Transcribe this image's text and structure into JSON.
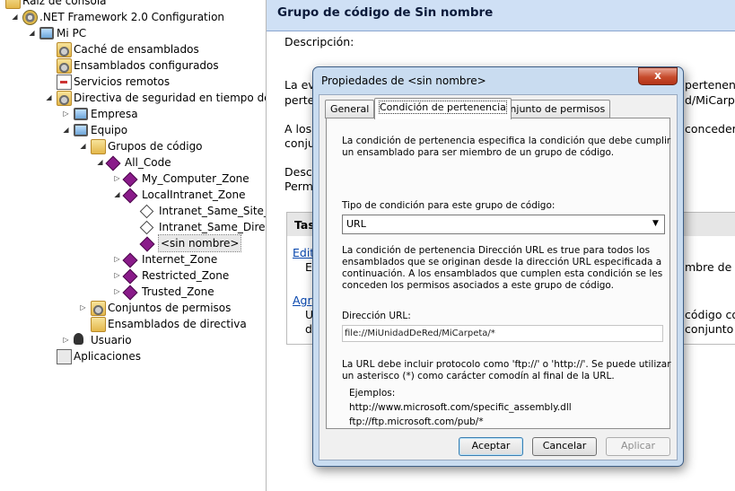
{
  "tree": [
    {
      "label": "Raíz de consola",
      "icon": "folder-icon",
      "level": 0
    },
    {
      "label": ".NET Framework 2.0 Configuration",
      "icon": "config-icon",
      "level": 1
    },
    {
      "label": "Mi PC",
      "icon": "computer-icon",
      "level": 2
    },
    {
      "label": "Caché de ensamblados",
      "icon": "gear-folder-icon",
      "level": 3
    },
    {
      "label": "Ensamblados configurados",
      "icon": "gear-folder-icon",
      "level": 3
    },
    {
      "label": "Servicios remotos",
      "icon": "services-icon",
      "level": 3
    },
    {
      "label": "Directiva de seguridad en tiempo de ejec",
      "icon": "policy-folder-icon",
      "level": 3
    },
    {
      "label": "Empresa",
      "icon": "enterprise-icon",
      "level": 4
    },
    {
      "label": "Equipo",
      "icon": "computer-icon",
      "level": 4
    },
    {
      "label": "Grupos de código",
      "icon": "folder-icon",
      "level": 5
    },
    {
      "label": "All_Code",
      "icon": "code-group-icon",
      "level": 6
    },
    {
      "label": "My_Computer_Zone",
      "icon": "code-group-icon",
      "level": 7
    },
    {
      "label": "LocalIntranet_Zone",
      "icon": "code-group-icon",
      "level": 7
    },
    {
      "label": "Intranet_Same_Site_Ac",
      "icon": "white-diamond-icon",
      "level": 8
    },
    {
      "label": "Intranet_Same_Directo",
      "icon": "white-diamond-icon",
      "level": 8
    },
    {
      "label": "<sin nombre>",
      "icon": "code-group-icon",
      "level": 8,
      "selected": true
    },
    {
      "label": "Internet_Zone",
      "icon": "code-group-icon",
      "level": 7
    },
    {
      "label": "Restricted_Zone",
      "icon": "code-group-icon",
      "level": 7
    },
    {
      "label": "Trusted_Zone",
      "icon": "code-group-icon",
      "level": 7
    },
    {
      "label": "Conjuntos de permisos",
      "icon": "gear-folder-icon",
      "level": 5
    },
    {
      "label": "Ensamblados de directiva",
      "icon": "folder-icon",
      "level": 5
    },
    {
      "label": "Usuario",
      "icon": "user-icon",
      "level": 4
    },
    {
      "label": "Aplicaciones",
      "icon": "applications-icon",
      "level": 3
    }
  ],
  "right": {
    "title": "Grupo de código de Sin nombre",
    "description_label": "Descripción:",
    "para1_line1_left": "La ev",
    "para1_line1_right": "pertenenc",
    "para1_line2_left": "perte",
    "para1_line2_right": "d/MiCarp",
    "para2_line1_left": "A los",
    "para2_line1_right": "conceder",
    "para2_line2_left": "conju",
    "para3_line1_left": "Desc",
    "para3_line2_left": "Perm",
    "tasks_label": "Tas",
    "task1_link": "Edit",
    "task1_line_left": "E",
    "task1_line_right": "mbre de c",
    "task2_link": "Agr",
    "task2_line1_left": "U",
    "task2_line1_right": "código co",
    "task2_line2_left": "d",
    "task2_line2_right": "conjunto d"
  },
  "dialog": {
    "title": "Propiedades de <sin nombre>",
    "close_glyph": "x",
    "tabs": [
      "General",
      "Condición de pertenencia",
      "Conjunto de permisos"
    ],
    "active_tab": "Condición de pertenencia",
    "intro_lines": [
      "La condición de pertenencia especifica la condición que debe cumplir",
      "un ensamblado para ser miembro de un grupo de código."
    ],
    "condition_type_label": "Tipo de condición para este grupo de código:",
    "condition_type_value": "URL",
    "url_desc_lines": [
      "La condición de pertenencia Dirección URL es true para todos los",
      "ensamblados que se originan desde la dirección URL especificada a",
      "continuación. A los ensamblados que cumplen esta condición se les",
      "conceden los permisos asociados a este grupo de código."
    ],
    "url_label": "Dirección URL:",
    "url_value": "file://MiUnidadDeRed/MiCarpeta/*",
    "hint_lines": [
      "La URL debe incluir protocolo como 'ftp://' o 'http://'. Se puede utilizar",
      "un asterisco (*) como carácter comodín al final de la URL."
    ],
    "examples_label": "Ejemplos:",
    "example1": "http://www.microsoft.com/specific_assembly.dll",
    "example2": "ftp://ftp.microsoft.com/pub/*",
    "buttons": {
      "ok": "Aceptar",
      "cancel": "Cancelar",
      "apply": "Aplicar"
    }
  }
}
